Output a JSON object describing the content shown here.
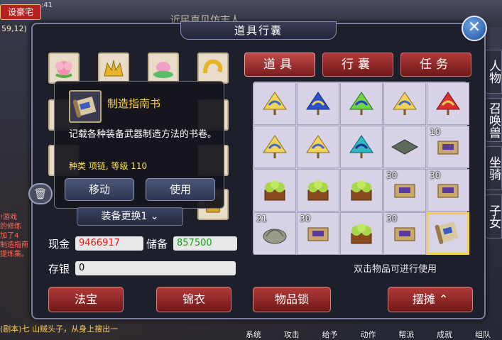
{
  "background": {
    "top_left_label": "设豪宅",
    "coords": "59,12)",
    "time": ":41",
    "top_hint": "近民直见仿志人",
    "chat_lines": [
      "!游戏",
      "的修炼",
      "加了4",
      "制造指南",
      "提炼集。"
    ],
    "bottom_chat": "(剧本)七\n山贼头子，从身上搜出一",
    "right_tabs": [
      "人物",
      "召唤兽",
      "坐骑",
      "子女"
    ],
    "bottom_bar": [
      "系统",
      "攻击",
      "给予",
      "动作",
      "帮派",
      "成就",
      "组队"
    ]
  },
  "window": {
    "title": "道具行囊",
    "close_icon": "close-x-icon"
  },
  "tooltip": {
    "name": "制造指南书",
    "description": "记载各种装备武器制造方法的书卷。",
    "attr_label": "种类 项链, 等级",
    "attr_value": "110",
    "move_label": "移动",
    "use_label": "使用"
  },
  "equip_switch_label": "装备更换1 ⌄",
  "money": {
    "cash_label": "现金",
    "cash_value": "9466917",
    "reserve_label": "储备",
    "reserve_value": "857500",
    "deposit_label": "存银",
    "deposit_value": "0",
    "cash_color": "#e01818",
    "reserve_color": "#18a018"
  },
  "tabs": [
    {
      "label": "道具",
      "active": true
    },
    {
      "label": "行囊",
      "active": false
    },
    {
      "label": "任务",
      "active": false
    }
  ],
  "grid": [
    [
      {
        "item": "gold-fan",
        "qty": ""
      },
      {
        "item": "blue-fan",
        "qty": ""
      },
      {
        "item": "green-fan",
        "qty": ""
      },
      {
        "item": "gold-fan",
        "qty": ""
      },
      {
        "item": "red-fan",
        "qty": ""
      }
    ],
    [
      {
        "item": "gold-fan",
        "qty": ""
      },
      {
        "item": "gold-fan",
        "qty": ""
      },
      {
        "item": "teal-fan",
        "qty": ""
      },
      {
        "item": "stone-slab",
        "qty": ""
      },
      {
        "item": "scroll-bundle",
        "qty": "10"
      }
    ],
    [
      {
        "item": "fruit-basket",
        "qty": ""
      },
      {
        "item": "fruit-basket",
        "qty": ""
      },
      {
        "item": "fruit-basket",
        "qty": ""
      },
      {
        "item": "scroll-bundle",
        "qty": "30"
      },
      {
        "item": "scroll-bundle",
        "qty": "30"
      }
    ],
    [
      {
        "item": "shell",
        "qty": "21"
      },
      {
        "item": "scroll-bundle",
        "qty": "30"
      },
      {
        "item": "fruit-basket",
        "qty": ""
      },
      {
        "item": "scroll-bundle",
        "qty": "30"
      },
      {
        "item": "scroll",
        "qty": "",
        "selected": true
      }
    ]
  ],
  "hint": "双击物品可进行使用",
  "buttons": {
    "fabao": "法宝",
    "jinyi": "锦衣",
    "lock": "物品锁",
    "stall": "摆摊 ⌃"
  }
}
